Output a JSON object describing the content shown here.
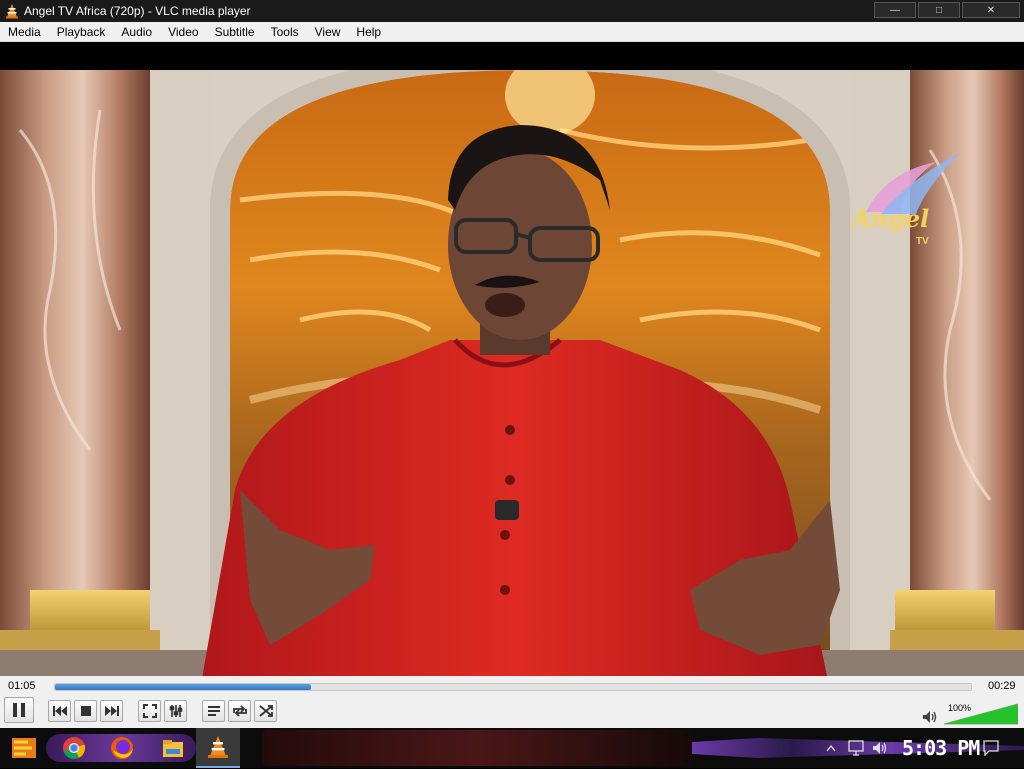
{
  "window": {
    "title": "Angel TV Africa (720p) - VLC media player",
    "controls": {
      "minimize": "—",
      "maximize": "□",
      "close": "✕"
    }
  },
  "menu": [
    "Media",
    "Playback",
    "Audio",
    "Video",
    "Subtitle",
    "Tools",
    "View",
    "Help"
  ],
  "video": {
    "channel_logo_text": "Angel",
    "channel_logo_sub": "TV"
  },
  "player": {
    "elapsed": "01:05",
    "remaining": "00:29",
    "progress": 0.28,
    "volume_label": "100%",
    "volume": 1.0,
    "buttons": [
      "pause-icon",
      "previous-icon",
      "stop-icon",
      "next-icon",
      "fullscreen-icon",
      "extended-settings-icon",
      "playlist-icon",
      "loop-icon",
      "shuffle-icon",
      "speaker-icon"
    ]
  },
  "taskbar": {
    "clock": "5:03 PM",
    "apps": [
      "start-icon",
      "chrome-icon",
      "firefox-icon",
      "file-explorer-icon",
      "vlc-icon"
    ],
    "tray": [
      "chevron-up-icon",
      "network-icon",
      "volume-icon",
      "notification-icon"
    ]
  },
  "colors": {
    "titlebar": "#1a1a1a",
    "seek_fill": "#2f78c4",
    "volume_fill": "#27c22b",
    "shirt_red": "#d8241e",
    "sky_orange": "#e0871e"
  }
}
